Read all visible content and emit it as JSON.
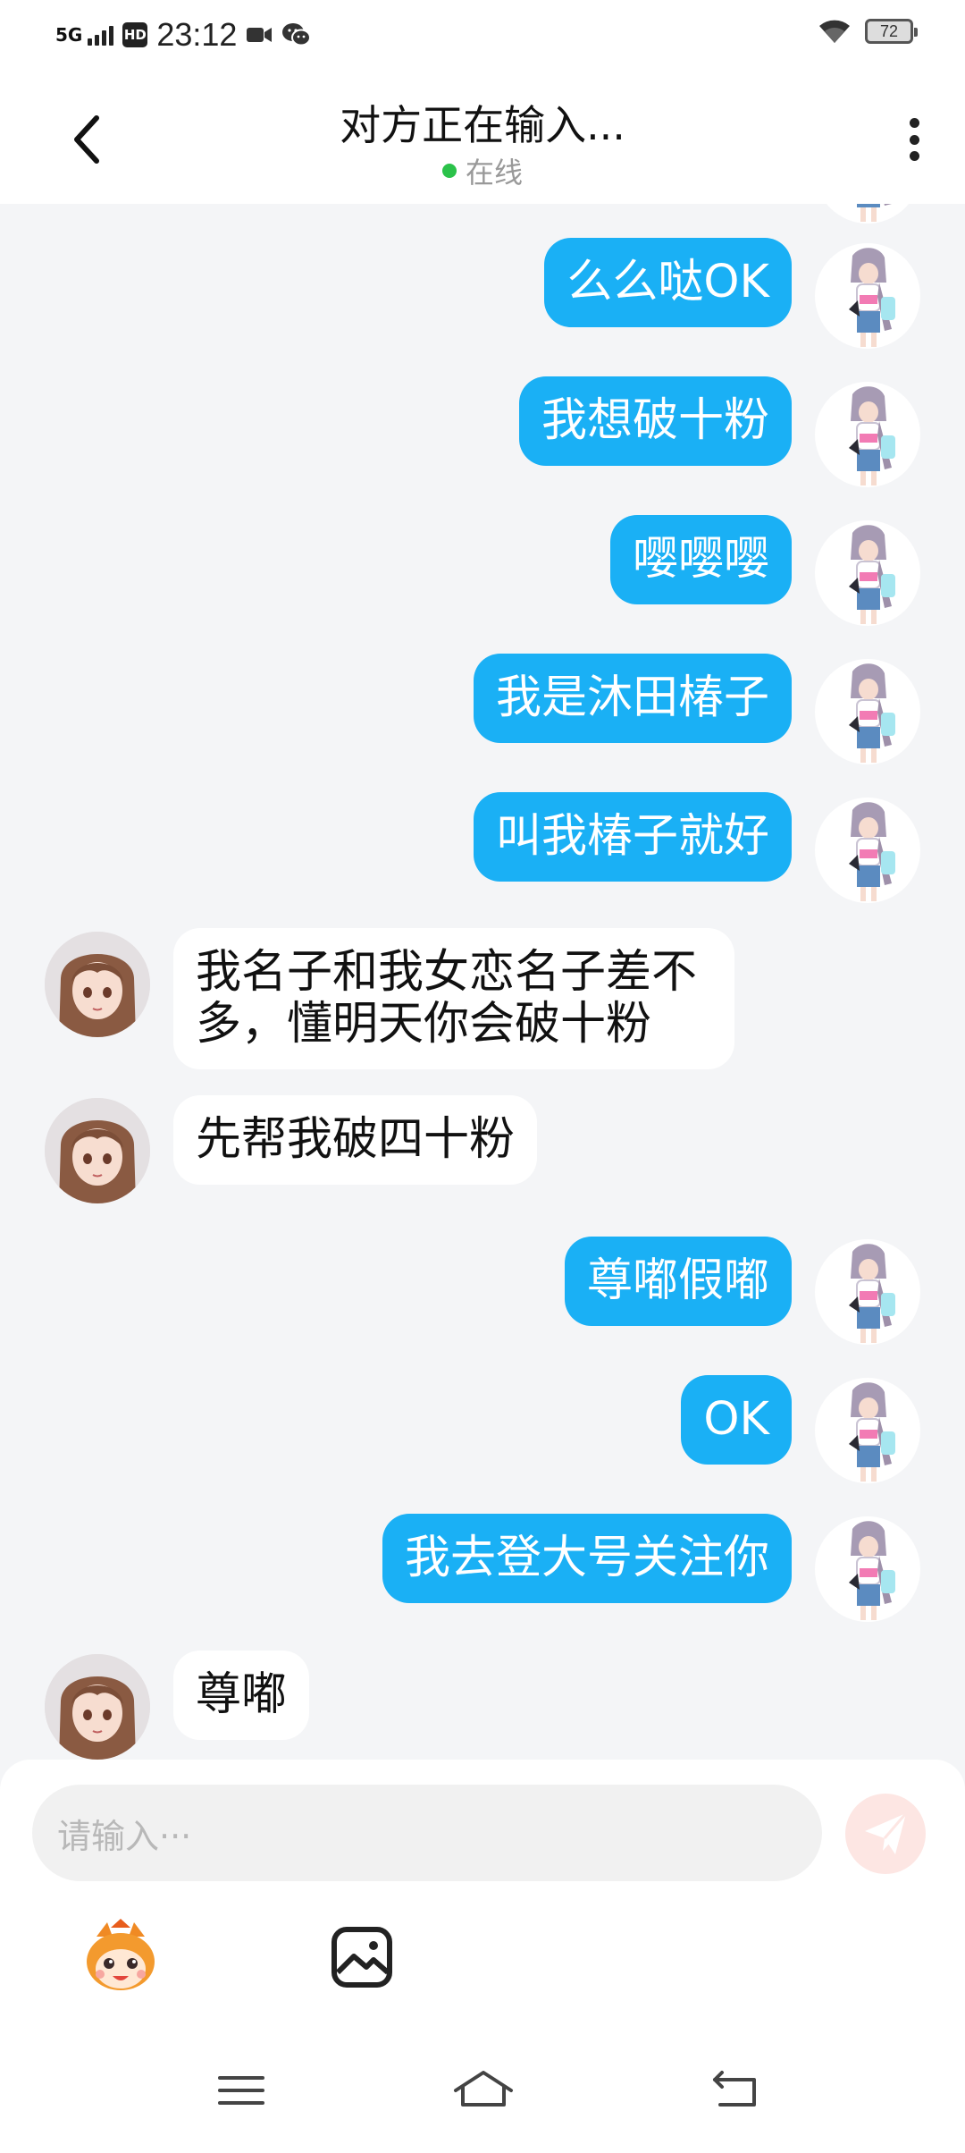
{
  "status_bar": {
    "network": "5G",
    "hd": "HD",
    "time": "23:12",
    "battery": "72",
    "icons": [
      "signal-icon",
      "video-icon",
      "wechat-icon",
      "wifi-icon",
      "battery-icon"
    ]
  },
  "header": {
    "title": "对方正在输入...",
    "status": "在线",
    "status_color": "#2bc24a"
  },
  "messages": [
    {
      "from": "me",
      "text": "么么哒OK"
    },
    {
      "from": "me",
      "text": "我想破十粉"
    },
    {
      "from": "me",
      "text": "嘤嘤嘤"
    },
    {
      "from": "me",
      "text": "我是沐田椿子"
    },
    {
      "from": "me",
      "text": "叫我椿子就好"
    },
    {
      "from": "other",
      "line1": "我名子和我女恋名子差不",
      "line2": "多，懂明天你会破十粉"
    },
    {
      "from": "other",
      "text": "先帮我破四十粉"
    },
    {
      "from": "me",
      "text": "尊嘟假嘟"
    },
    {
      "from": "me",
      "text": "OK"
    },
    {
      "from": "me",
      "text": "我去登大号关注你"
    },
    {
      "from": "other",
      "text": "尊嘟"
    }
  ],
  "composer": {
    "placeholder": "请输入···",
    "send_icon": "paper-plane-icon",
    "tools": [
      "emoji-mascot-icon",
      "image-icon"
    ]
  },
  "colors": {
    "my_bubble": "#1ab0f5",
    "other_bubble": "#ffffff",
    "background": "#f4f5f7"
  }
}
